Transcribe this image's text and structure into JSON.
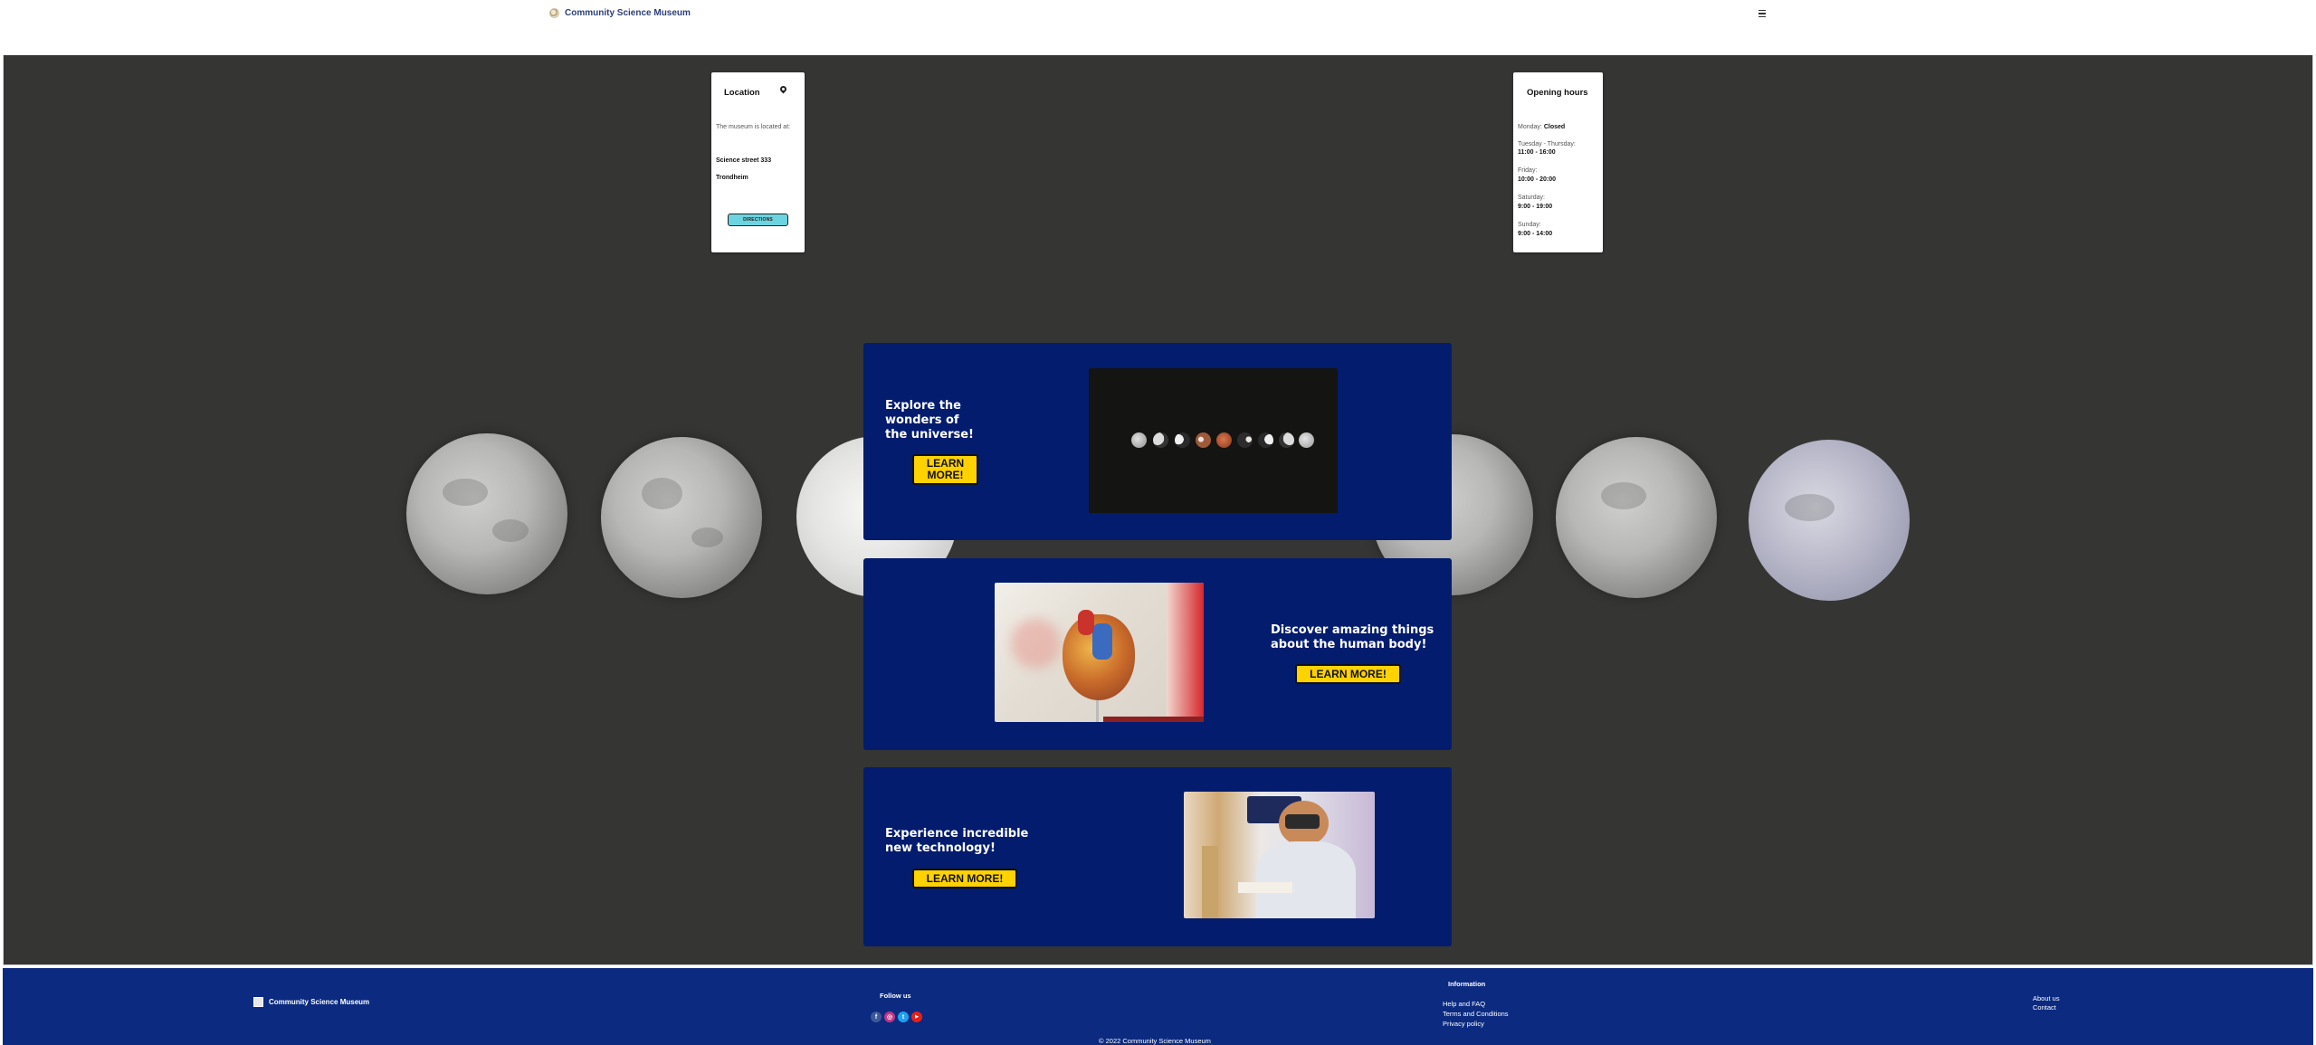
{
  "header": {
    "brand_name": "Community Science Museum",
    "logo_icon": "museum-logo-icon",
    "menu_icon": "hamburger-menu-icon"
  },
  "location_card": {
    "title": "Location",
    "icon": "map-pin-icon",
    "intro": "The museum is located at:",
    "street": "Science street 333",
    "city": "Trondheim",
    "button_label": "DIRECTIONS"
  },
  "hours_card": {
    "title": "Opening hours",
    "rows": [
      {
        "day": "Monday:",
        "time": "Closed"
      },
      {
        "day": "Tuesday - Thursday:",
        "time": "11:00 - 16:00"
      },
      {
        "day": "Friday:",
        "time": "10:00 - 20:00"
      },
      {
        "day": "Saturday:",
        "time": "9:00 - 19:00"
      },
      {
        "day": "Sunday:",
        "time": "9:00 - 14:00"
      }
    ]
  },
  "features": [
    {
      "title": "Explore the wonders of the universe!",
      "button": "LEARN MORE!",
      "image": "lunar-eclipse-phases"
    },
    {
      "title": "Discover amazing things about the human body!",
      "button": "LEARN MORE!",
      "image": "anatomical-heart-model"
    },
    {
      "title": "Experience incredible new technology!",
      "button": "LEARN MORE!",
      "image": "person-with-vr-headset"
    }
  ],
  "footer": {
    "brand_name": "Community Science Museum",
    "follow_heading": "Follow us",
    "social": [
      {
        "icon": "facebook-icon",
        "glyph": "f",
        "color": "#3b5998"
      },
      {
        "icon": "instagram-icon",
        "glyph": "◎",
        "color": "#c13584"
      },
      {
        "icon": "twitter-icon",
        "glyph": "t",
        "color": "#1da1f2"
      },
      {
        "icon": "youtube-icon",
        "glyph": "▶",
        "color": "#e62117"
      }
    ],
    "info_heading": "Information",
    "info_links": [
      "Help and FAQ",
      "Terms and Conditions",
      "Privacy policy"
    ],
    "right_links": [
      "About us",
      "Contact"
    ],
    "copyright": "© 2022 Community Science Museum"
  },
  "colors": {
    "hero_bg": "#353634",
    "panel_bg": "#031c6e",
    "button_yellow": "#ffd200",
    "directions_cyan": "#6bd4e0",
    "footer_bg": "#0b2a80"
  }
}
